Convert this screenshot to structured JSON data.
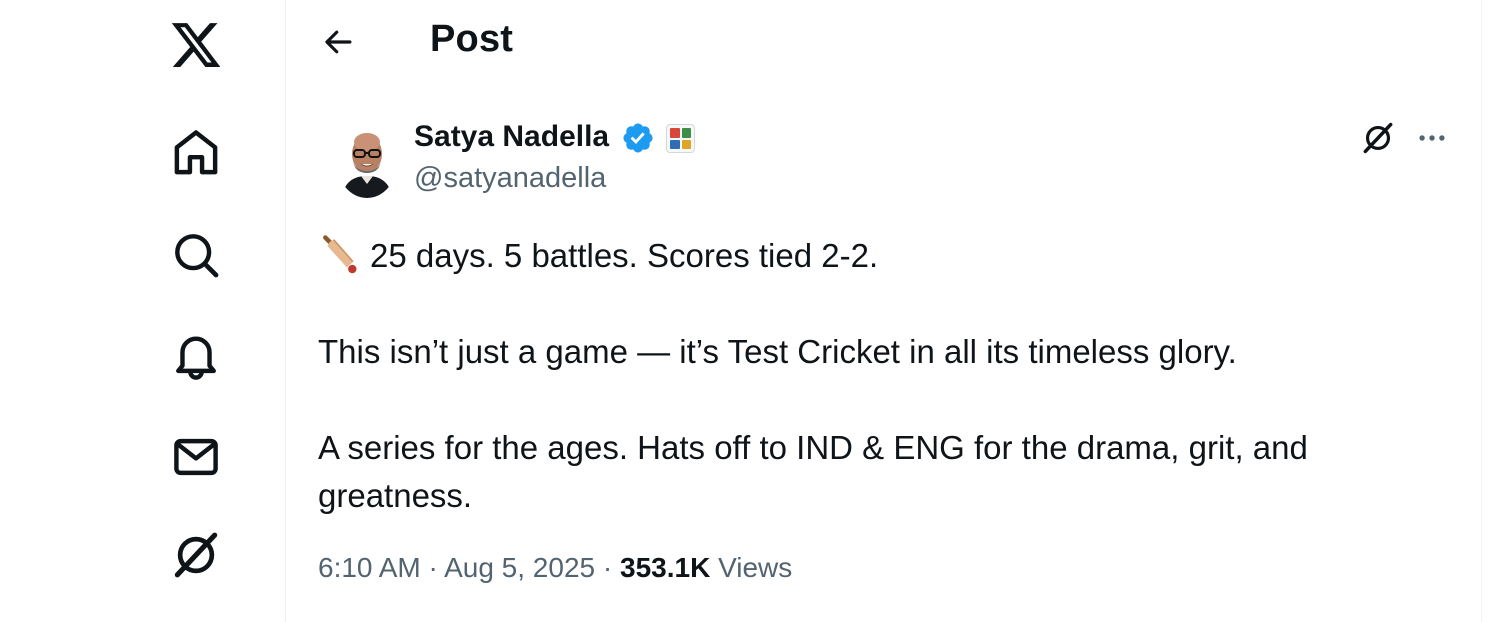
{
  "header": {
    "title": "Post"
  },
  "sidebar": {
    "items": [
      {
        "icon": "x-logo-icon"
      },
      {
        "icon": "home-icon"
      },
      {
        "icon": "search-icon"
      },
      {
        "icon": "notifications-bell-icon"
      },
      {
        "icon": "messages-mail-icon"
      },
      {
        "icon": "grok-icon"
      }
    ]
  },
  "post": {
    "author": {
      "name": "Satya Nadella",
      "handle": "@satyanadella",
      "verified": true
    },
    "paragraphs": [
      "25 days. 5 battles. Scores tied 2-2.",
      "This isn’t just a game — it’s Test Cricket in all its timeless glory.",
      "A series for the ages. Hats off to IND & ENG for the drama, grit, and greatness."
    ],
    "emoji": "cricket-bat-icon",
    "time": "6:10 AM",
    "separator": "·",
    "date": "Aug 5, 2025",
    "views_count": "353.1K",
    "views_label": "Views"
  },
  "colors": {
    "text": "#0f1419",
    "secondary": "#536471",
    "verified": "#1d9bf0"
  }
}
